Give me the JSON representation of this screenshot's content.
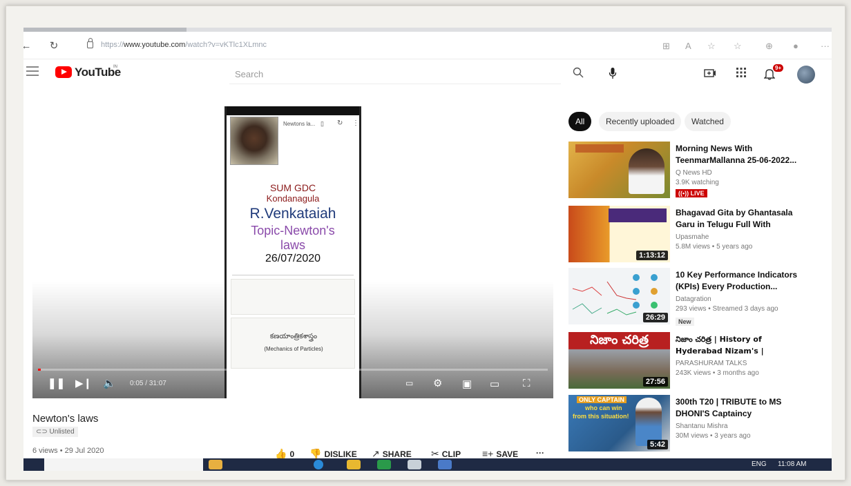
{
  "browser": {
    "url_prefix": "https://",
    "url_host": "www.youtube.com",
    "url_path": "/watch?v=vKTlc1XLmnc"
  },
  "header": {
    "logo_text": "YouTube",
    "logo_country": "IN",
    "search_placeholder": "Search",
    "notification_count": "9+"
  },
  "player": {
    "slide_header": "Newtons la...",
    "slide_line1": "SUM GDC",
    "slide_line2": "Kondanagula",
    "slide_name": "R.Venkataiah",
    "slide_topic1": "Topic-Newton's",
    "slide_topic2": "laws",
    "slide_date": "26/07/2020",
    "slide_telugu": "కణయాంత్రికశాస్త్రం",
    "slide_subtitle": "(Mechanics of Particles)",
    "time_current": "0:05",
    "time_total": "31:07",
    "progress_fraction": 0.003
  },
  "video": {
    "title": "Newton's laws",
    "visibility": "Unlisted",
    "meta": "6 views • 29 Jul 2020",
    "like_count": "0",
    "dislike_label": "DISLIKE",
    "share_label": "SHARE",
    "clip_label": "CLIP",
    "save_label": "SAVE",
    "more_label": "···"
  },
  "chips": [
    "All",
    "Recently uploaded",
    "Watched"
  ],
  "recommendations": [
    {
      "title": "Morning News With TeenmarMallanna 25-06-2022...",
      "channel": "Q News HD",
      "views": "3.9K watching",
      "badge": "((•)) LIVE",
      "thumb_color": "#c98a2a"
    },
    {
      "title": "Bhagavad Gita by Ghantasala Garu in Telugu Full With Lyrics...",
      "channel": "Upasmahe",
      "views": "5.8M views • 5 years ago",
      "duration": "1:13:12",
      "thumb_color": "#7a4a9a"
    },
    {
      "title": "10 Key Performance Indicators (KPIs) Every Production...",
      "channel": "Datagration",
      "views": "293 views • Streamed 3 days ago",
      "badge": "New",
      "duration": "26:29",
      "thumb_color": "#f2f4f6"
    },
    {
      "title": "నిజాం చరిత్ర | History of Hyderabad Nizam's | Nizam's...",
      "channel": "PARASHURAM TALKS",
      "views": "243K views • 3 months ago",
      "duration": "27:56",
      "thumb_text": "నిజాం చరిత్ర",
      "thumb_color": "#b82020"
    },
    {
      "title": "300th T20 | TRIBUTE to MS DHONI'S Captaincy",
      "channel": "Shantanu Mishra",
      "views": "30M views • 3 years ago",
      "duration": "5:42",
      "thumb_line1": "ONLY CAPTAIN",
      "thumb_line2": "who can win",
      "thumb_line3": "from this situation!",
      "thumb_color": "#2a5a8a"
    }
  ],
  "taskbar": {
    "language": "ENG",
    "clock": "11:08 AM"
  }
}
